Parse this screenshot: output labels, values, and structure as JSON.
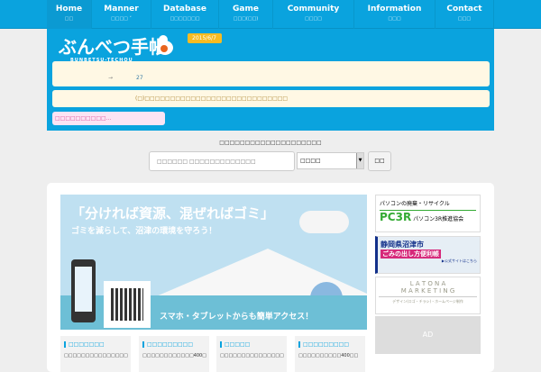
{
  "nav": [
    {
      "label": "Home",
      "sub": "□□"
    },
    {
      "label": "Manner",
      "sub": "□□□□ ˅"
    },
    {
      "label": "Database",
      "sub": "□□□□□□□"
    },
    {
      "label": "Game",
      "sub": "□□□(□□)"
    },
    {
      "label": "Community",
      "sub": "□□□□"
    },
    {
      "label": "Information",
      "sub": "□□□"
    },
    {
      "label": "Contact",
      "sub": "□□□"
    }
  ],
  "header": {
    "logo": "ぶんべつ手帳",
    "logo_sub": "BUNBETSU-TECHOU",
    "date": "2015/6/7",
    "info1_arrow": "→",
    "info1_value": "27",
    "info2": "(□)□□□□□□□□□□□□□□□□□□□□□□□□□□□□",
    "pink": "□□□□□□□□□□..."
  },
  "search": {
    "label": "□□□□□□□□□□□□□□□□□□□□",
    "placeholder": "□□□□□□ □□□□□□□□□□□□□",
    "select_value": "□□□□",
    "button": "□□"
  },
  "banner": {
    "headline": "「分ければ資源、混ぜればゴミ」",
    "subline": "ゴミを減らして、沼津の環境を守ろう！",
    "access": "スマホ・タブレットからも簡単アクセス！"
  },
  "ads": [
    {
      "title": "パソコンの廃棄・リサイクル",
      "brand": "PC3R",
      "org": "パソコン3R推進協会"
    },
    {
      "title": "静岡県沼津市",
      "sub": "ごみの出し方便利帳",
      "link": "▶公式サイトはこちら"
    },
    {
      "title": "L A T O N A",
      "sub": "M A R K E T I N G",
      "desc": "デザイン(ロゴ・チラシ)・ホームページ制作"
    },
    {
      "title": "AD"
    }
  ],
  "boxes": [
    {
      "title": "□□□□□□□",
      "text": "□□□□□□□□□□□□□□□"
    },
    {
      "title": "□□□□□□□□□",
      "text": "□□□□□□□□□□□□400□"
    },
    {
      "title": "□□□□□",
      "text": "□□□□□□□□□□□□□□□"
    },
    {
      "title": "□□□□□□□□□",
      "text": "□□□□□□□□□□400□□"
    }
  ]
}
